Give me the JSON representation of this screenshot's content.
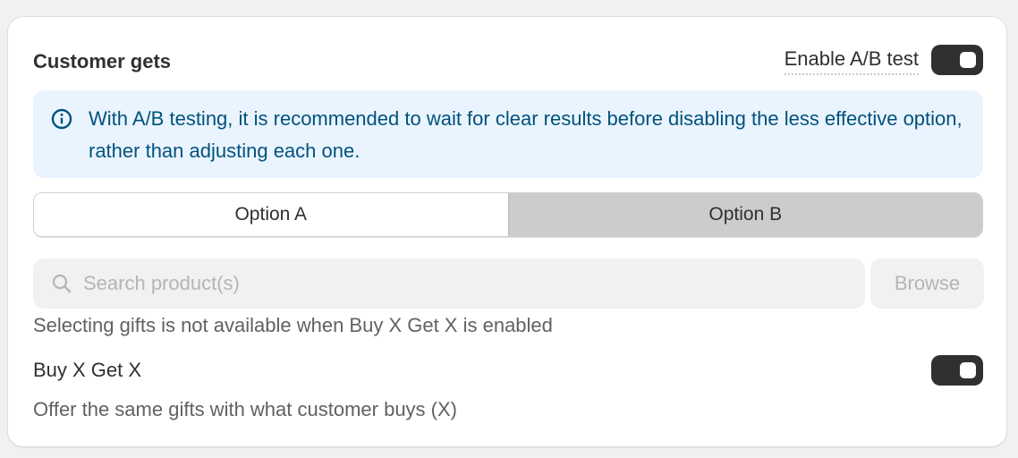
{
  "section": {
    "title": "Customer gets",
    "ab_test_label": "Enable A/B test",
    "ab_test_enabled": true
  },
  "banner": {
    "icon": "info-icon",
    "text": "With A/B testing, it is recommended to wait for clear results before disabling the less effective option, rather than adjusting each one.",
    "background_color": "#eaf4ff",
    "text_color": "#00527c"
  },
  "options": {
    "tabs": [
      {
        "label": "Option A",
        "selected": false
      },
      {
        "label": "Option B",
        "selected": true
      }
    ]
  },
  "search": {
    "icon": "search-icon",
    "placeholder": "Search product(s)",
    "value": "",
    "browse_label": "Browse",
    "help_text": "Selecting gifts is not available when Buy X Get X is enabled"
  },
  "buy_x_get_x": {
    "title": "Buy X Get X",
    "description": "Offer the same gifts with what customer buys (X)",
    "enabled": true
  },
  "colors": {
    "toggle_on": "#303030",
    "selected_tab": "#cccccc"
  }
}
